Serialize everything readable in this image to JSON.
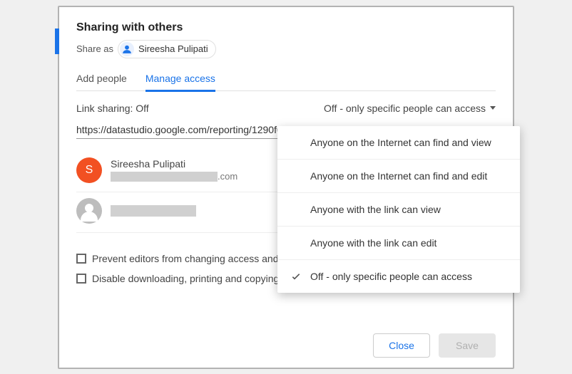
{
  "header": {
    "title": "Sharing with others",
    "share_as_label": "Share as",
    "current_user": "Sireesha Pulipati"
  },
  "tabs": {
    "add_people": "Add people",
    "manage_access": "Manage access"
  },
  "link_sharing": {
    "label": "Link sharing: Off",
    "selected": "Off - only specific people can access",
    "url": "https://datastudio.google.com/reporting/1290f0",
    "options": [
      "Anyone on the Internet can find and view",
      "Anyone on the Internet can find and edit",
      "Anyone with the link can view",
      "Anyone with the link can edit",
      "Off - only specific people can access"
    ]
  },
  "people": [
    {
      "name": "Sireesha Pulipati",
      "initial": "S",
      "email_suffix": ".com"
    }
  ],
  "settings": {
    "prevent_editors": "Prevent editors from changing access and a",
    "disable_download": "Disable downloading, printing and copying fo"
  },
  "footer": {
    "close": "Close",
    "save": "Save"
  }
}
